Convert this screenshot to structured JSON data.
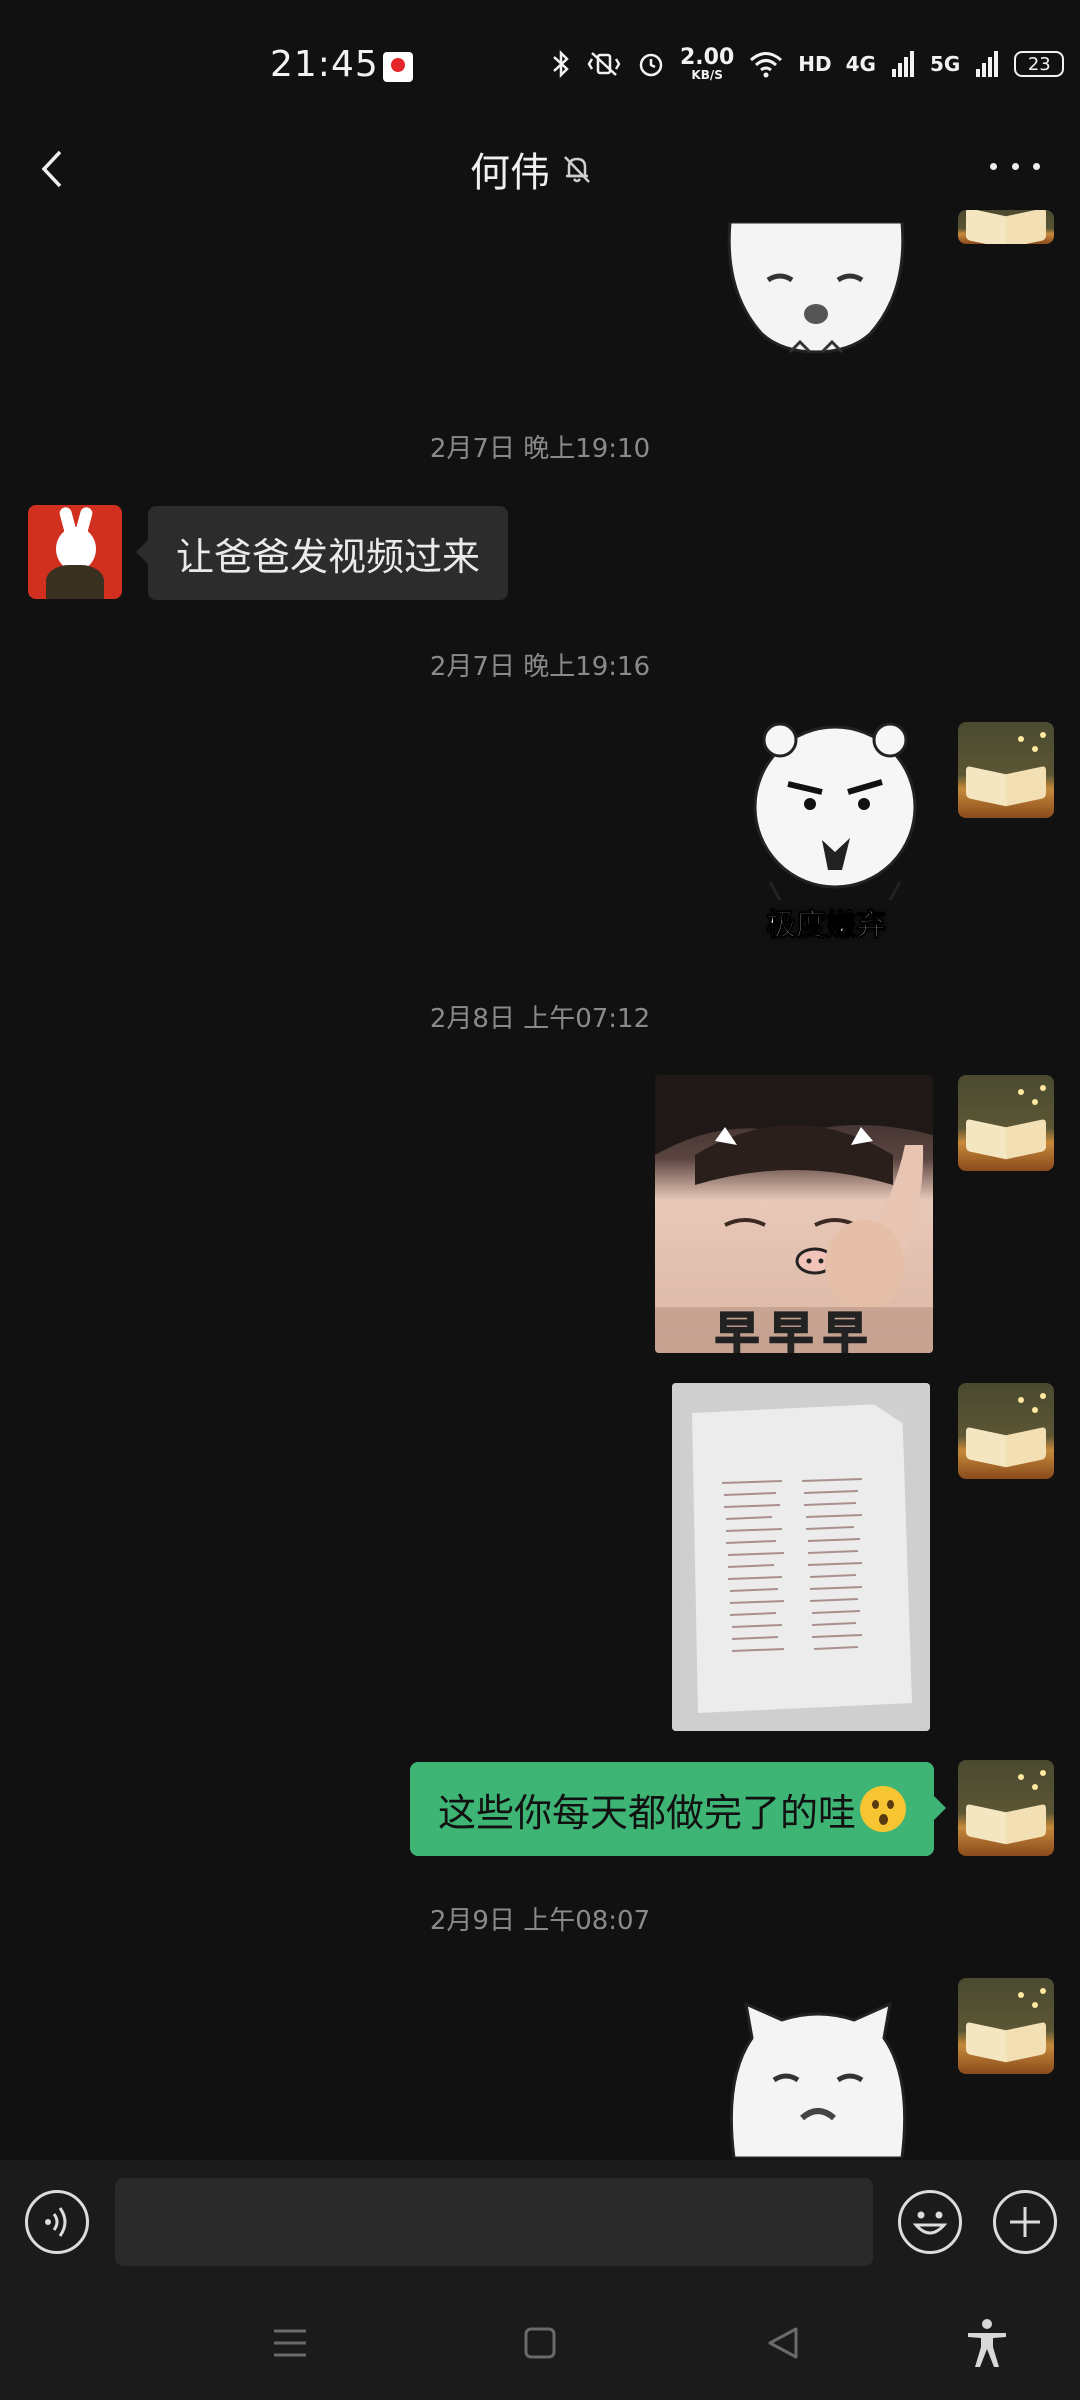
{
  "status_bar": {
    "time": "21:45",
    "speed_value": "2.00",
    "speed_unit": "KB/S",
    "hd_label": "HD",
    "net1": "4G",
    "net2": "5G",
    "battery": "23"
  },
  "header": {
    "contact_name": "何伟",
    "back_icon": "chevron-left-icon",
    "mute_icon": "bell-off-icon",
    "more_icon": "more-dots-icon"
  },
  "messages": {
    "ts1": "2月7日 晚上19:10",
    "msg1_text": "让爸爸发视频过来",
    "ts2": "2月7日 晚上19:16",
    "sticker_caption": "极度嫌弃",
    "ts3": "2月8日 上午07:12",
    "baby_caption": "早早早",
    "msg_out_text": "这些你每天都做完了的哇",
    "ts4": "2月9日 上午08:07"
  },
  "input_bar": {
    "voice_icon": "voice-icon",
    "input_value": "",
    "emoji_icon": "emoji-icon",
    "plus_icon": "plus-icon"
  },
  "system_nav": {
    "menu_icon": "menu-icon",
    "home_icon": "home-square-icon",
    "back_icon": "back-triangle-icon",
    "accessibility_icon": "accessibility-icon"
  },
  "colors": {
    "background": "#111111",
    "bubble_in": "#2c2c2c",
    "bubble_out": "#3eb575",
    "timestamp": "#8a8a8a"
  }
}
